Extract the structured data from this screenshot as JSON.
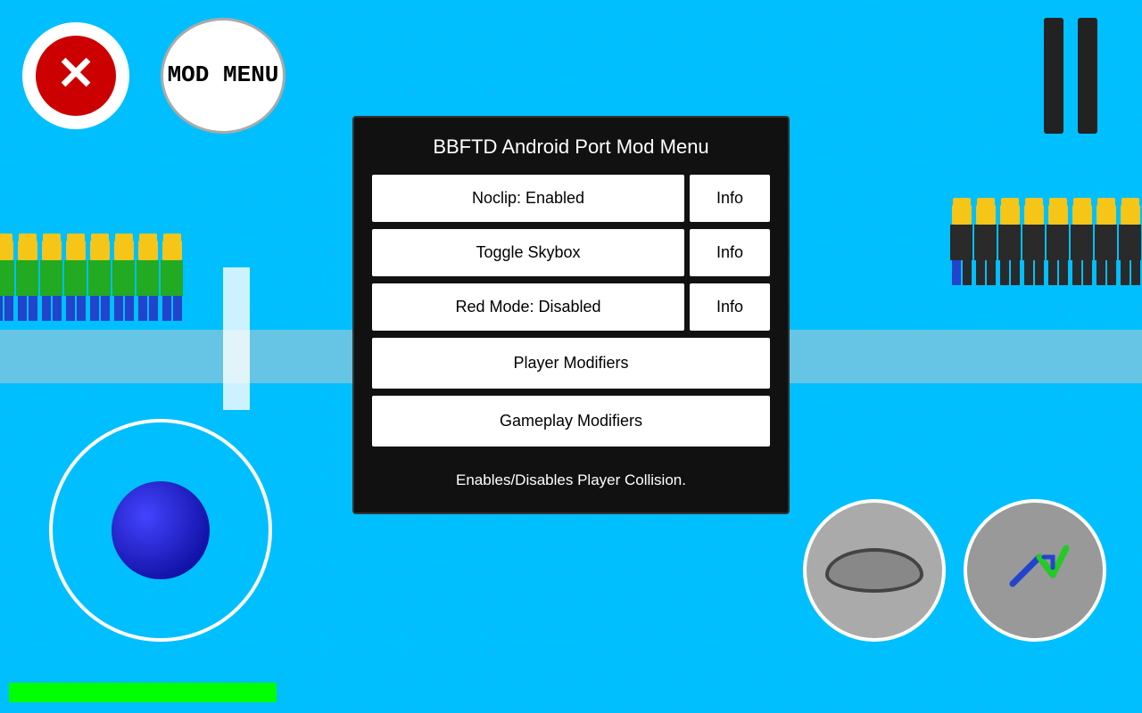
{
  "app": {
    "title": "BBFTD Android Port Mod Menu",
    "background_color": "#00bfff"
  },
  "buttons": {
    "close_label": "✕",
    "mod_menu_label": "MOD\nMENU",
    "noclip_label": "Noclip: Enabled",
    "noclip_info": "Info",
    "toggle_skybox_label": "Toggle Skybox",
    "toggle_skybox_info": "Info",
    "red_mode_label": "Red Mode: Disabled",
    "red_mode_info": "Info",
    "player_modifiers_label": "Player Modifiers",
    "gameplay_modifiers_label": "Gameplay Modifiers"
  },
  "description": {
    "text": "Enables/Disables Player Collision."
  },
  "pause": {
    "bars": 2
  }
}
